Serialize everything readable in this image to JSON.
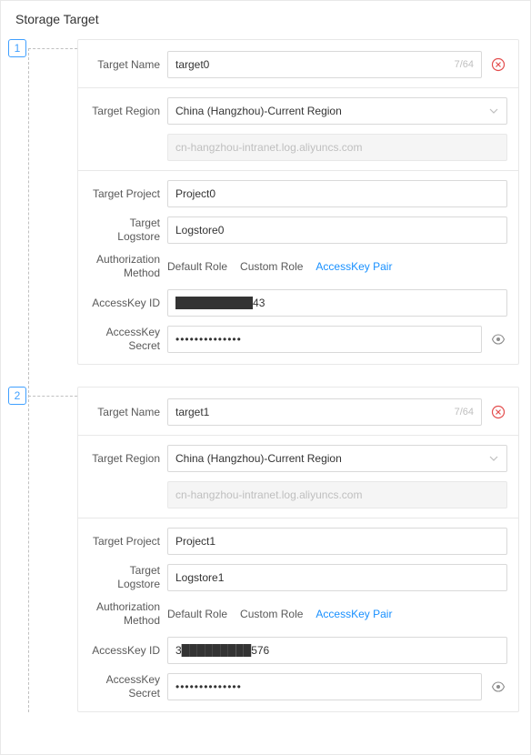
{
  "title": "Storage Target",
  "labels": {
    "targetName": "Target Name",
    "targetRegion": "Target Region",
    "targetProject": "Target Project",
    "targetLogstore": "Target Logstore",
    "authMethod": "Authorization Method",
    "akId": "AccessKey ID",
    "akSecret": "AccessKey Secret"
  },
  "authOptions": [
    "Default Role",
    "Custom Role",
    "AccessKey Pair"
  ],
  "targets": [
    {
      "index": "1",
      "name": "target0",
      "nameCount": "7/64",
      "region": "China (Hangzhou)-Current Region",
      "endpoint": "cn-hangzhou-intranet.log.aliyuncs.com",
      "project": "Project0",
      "logstore": "Logstore0",
      "authSelected": "AccessKey Pair",
      "akId": "██████████43",
      "akSecret": "••••••••••••••"
    },
    {
      "index": "2",
      "name": "target1",
      "nameCount": "7/64",
      "region": "China (Hangzhou)-Current Region",
      "endpoint": "cn-hangzhou-intranet.log.aliyuncs.com",
      "project": "Project1",
      "logstore": "Logstore1",
      "authSelected": "AccessKey Pair",
      "akId": "3█████████576",
      "akSecret": "••••••••••••••"
    }
  ]
}
